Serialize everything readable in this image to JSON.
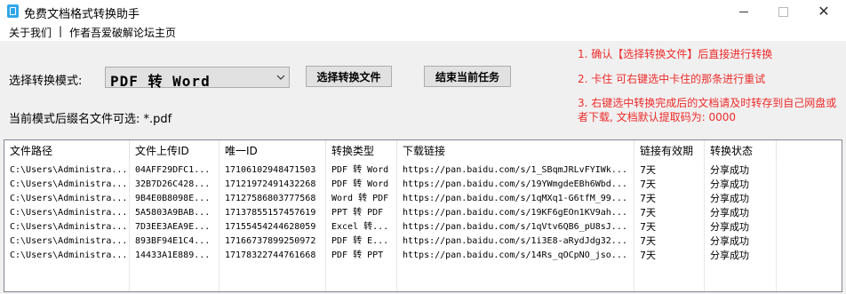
{
  "window": {
    "title": "免费文档格式转换助手",
    "minimize": "—",
    "close": "✕"
  },
  "menu": {
    "items": [
      "关于我们",
      "作者吾爱破解论坛主页"
    ],
    "separator": "|"
  },
  "mode": {
    "label": "选择转换模式:",
    "selected": "PDF 转 Word"
  },
  "buttons": {
    "select_file": "选择转换文件",
    "end_task": "结束当前任务"
  },
  "suffix_hint": "当前模式后缀名文件可选: *.pdf",
  "notes": {
    "color": "#ee2b2b",
    "items": [
      "1.  确认【选择转换文件】后直接进行转换",
      "2.  卡住  可右键选中卡住的那条进行重试",
      "3.  右键选中转换完成后的文档请及时转存到自己网盘或者下载, 文档默认提取码为: 0000"
    ]
  },
  "table": {
    "columns": [
      "文件路径",
      "文件上传ID",
      "唯一ID",
      "转换类型",
      "下载链接",
      "链接有效期",
      "转换状态"
    ],
    "rows": [
      [
        "C:\\Users\\Administra...",
        "04AFF29DFC1...",
        "17106102948471503",
        "PDF 转 Word",
        "https://pan.baidu.com/s/1_SBqmJRLvFYIWk...",
        "7天",
        "分享成功"
      ],
      [
        "C:\\Users\\Administra...",
        "32B7D26C428...",
        "17121972491432268",
        "PDF 转 Word",
        "https://pan.baidu.com/s/19YWmgdeEBh6Wbd...",
        "7天",
        "分享成功"
      ],
      [
        "C:\\Users\\Administra...",
        "9B4E0B8098E...",
        "17127586803777568",
        "Word 转 PDF",
        "https://pan.baidu.com/s/1qMXq1-G6tfM_99...",
        "7天",
        "分享成功"
      ],
      [
        "C:\\Users\\Administra...",
        "5A5803A9BAB...",
        "17137855157457619",
        "PPT 转 PDF",
        "https://pan.baidu.com/s/19KF6gEOn1KV9ah...",
        "7天",
        "分享成功"
      ],
      [
        "C:\\Users\\Administra...",
        "7D3EE3AEA9E...",
        "17155454244628059",
        "Excel 转...",
        "https://pan.baidu.com/s/1qVtv6QB6_pU8sJ...",
        "7天",
        "分享成功"
      ],
      [
        "C:\\Users\\Administra...",
        "893BF94E1C4...",
        "17166737899250972",
        "PDF 转 E...",
        "https://pan.baidu.com/s/1i3E8-aRydJdg32...",
        "7天",
        "分享成功"
      ],
      [
        "C:\\Users\\Administra...",
        "14433A1E889...",
        "17178322744761668",
        "PDF 转 PPT",
        "https://pan.baidu.com/s/14Rs_qOCpNO_jso...",
        "7天",
        "分享成功"
      ]
    ]
  },
  "icons": {
    "app": "document-app-icon",
    "dropdown": "chevron-down-icon"
  }
}
